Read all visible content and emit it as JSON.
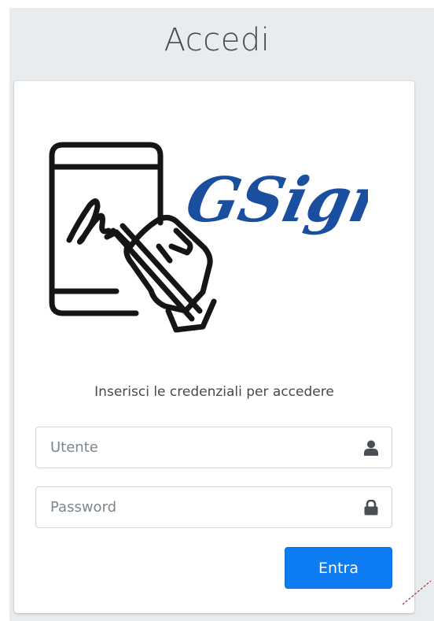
{
  "page": {
    "title": "Accedi"
  },
  "logo": {
    "wordmark": "GSign",
    "wordmark_color": "#1a4fa0",
    "icon": "tablet-signing-hand-icon"
  },
  "login": {
    "message": "Inserisci le credenziali per accedere",
    "username": {
      "value": "",
      "placeholder": "Utente",
      "icon": "user-icon"
    },
    "password": {
      "value": "",
      "placeholder": "Password",
      "icon": "lock-icon"
    },
    "submit_label": "Entra"
  },
  "colors": {
    "page_background": "#e9ecef",
    "card_background": "#ffffff",
    "primary_button": "#0d7bf1",
    "text": "#444a50",
    "input_border": "#ced4da"
  }
}
